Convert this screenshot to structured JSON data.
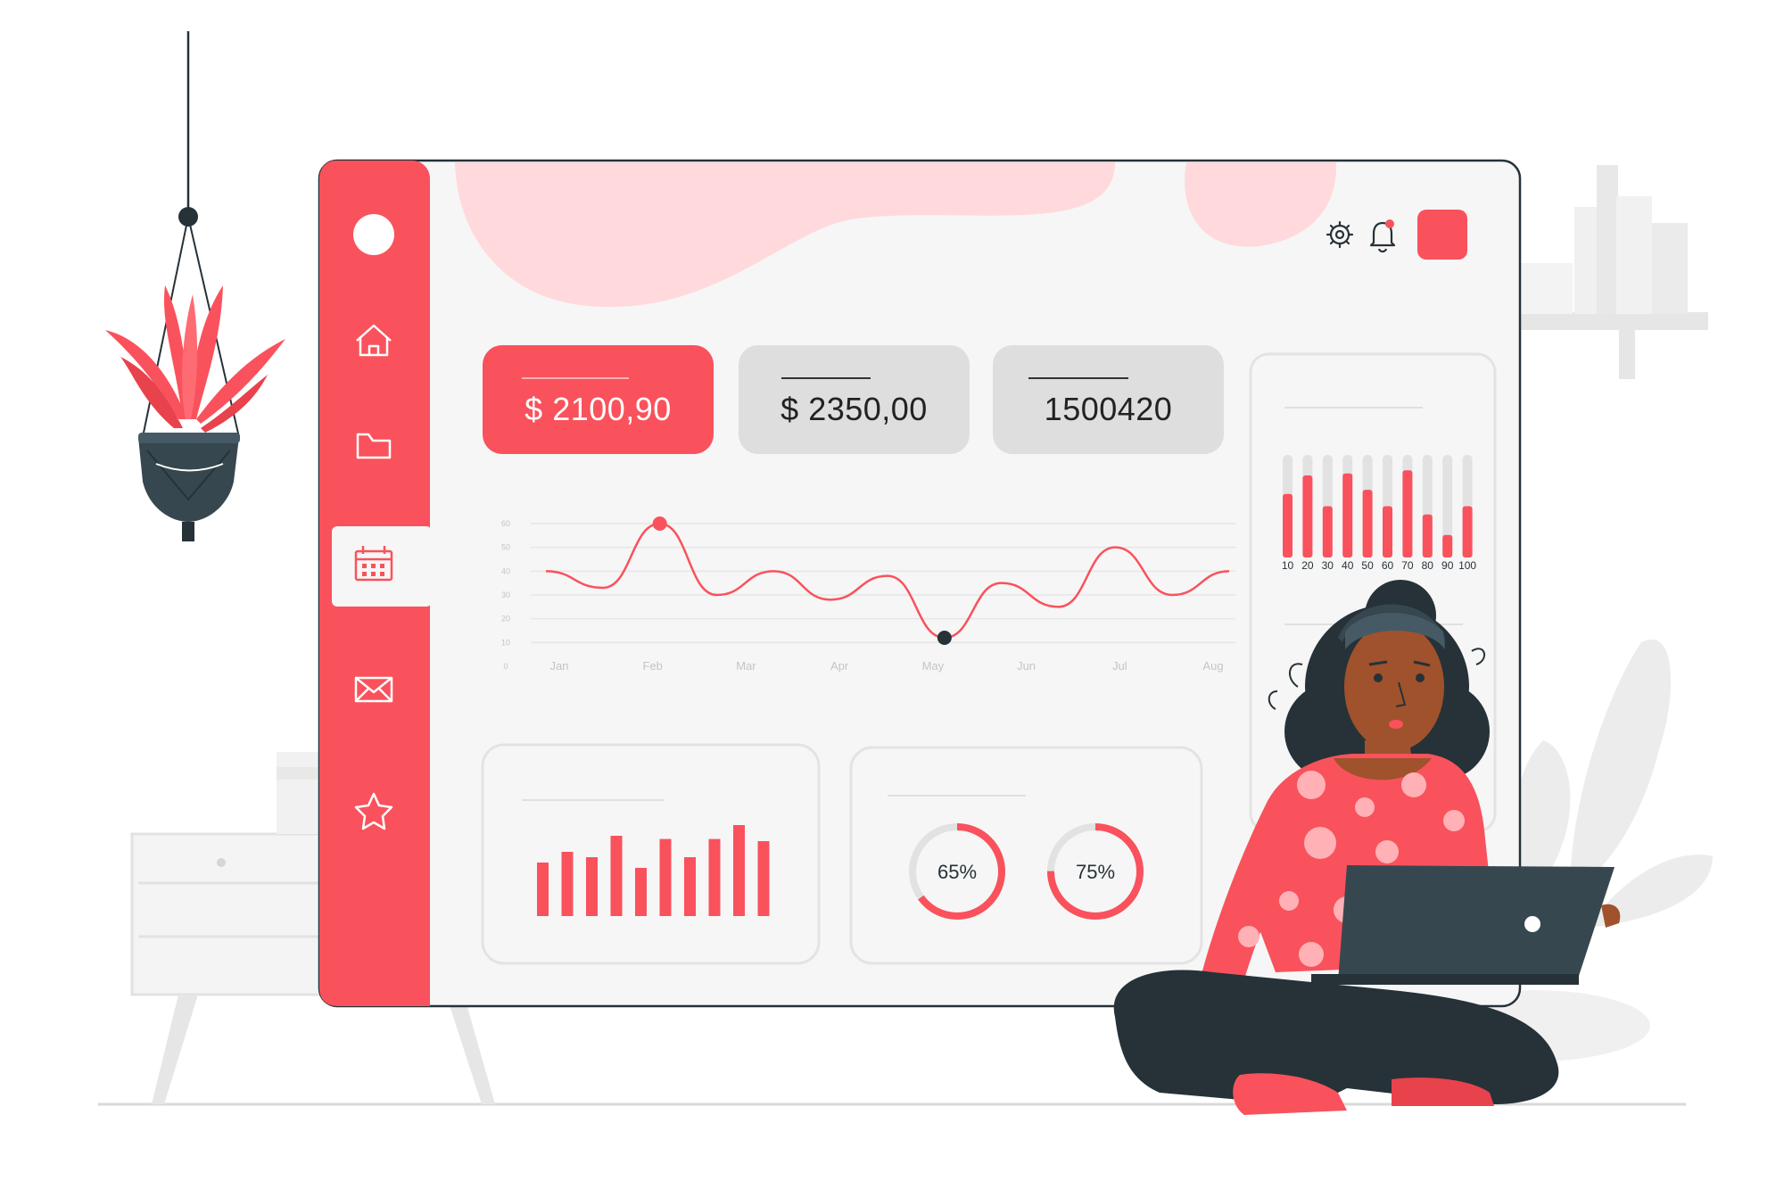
{
  "colors": {
    "accent": "#f9525c",
    "accent_light": "#ffd9dc",
    "grey_card": "#dedede",
    "dark": "#263238",
    "panel_bg": "#f6f6f6"
  },
  "sidebar": {
    "items": [
      {
        "name": "avatar",
        "icon": "circle"
      },
      {
        "name": "home",
        "icon": "home-icon"
      },
      {
        "name": "folder",
        "icon": "folder-icon"
      },
      {
        "name": "calendar",
        "icon": "calendar-icon",
        "active": true
      },
      {
        "name": "mail",
        "icon": "mail-icon"
      },
      {
        "name": "star",
        "icon": "star-icon"
      }
    ]
  },
  "header": {
    "icons": [
      "gear-icon",
      "bell-icon",
      "profile-square"
    ]
  },
  "stats": [
    {
      "value": "$ 2100,90",
      "style": "accent"
    },
    {
      "value": "$ 2350,00",
      "style": "grey"
    },
    {
      "value": "1500420",
      "style": "grey"
    }
  ],
  "chart_data": [
    {
      "type": "line",
      "categories": [
        "Jan",
        "Feb",
        "Mar",
        "Apr",
        "May",
        "Jun",
        "Jul",
        "Aug"
      ],
      "y_ticks": [
        0,
        10,
        20,
        30,
        40,
        50,
        60
      ],
      "ylim": [
        0,
        60
      ],
      "values": [
        40,
        33,
        60,
        30,
        40,
        28,
        38,
        12,
        35,
        25,
        50,
        30,
        40
      ],
      "highlight": [
        {
          "index": 2,
          "color": "#f9525c"
        },
        {
          "index": 7,
          "color": "#263238"
        }
      ],
      "grid": true
    },
    {
      "type": "bar",
      "categories": [
        "10",
        "20",
        "30",
        "40",
        "50",
        "60",
        "70",
        "80",
        "90",
        "100"
      ],
      "values": [
        62,
        80,
        50,
        82,
        66,
        50,
        85,
        42,
        22,
        50
      ],
      "ylim": [
        0,
        100
      ],
      "stacked_background": true
    },
    {
      "type": "bar",
      "values": [
        50,
        60,
        55,
        75,
        45,
        72,
        55,
        72,
        85,
        70
      ],
      "ylim": [
        0,
        100
      ]
    },
    {
      "type": "pie",
      "donuts": [
        {
          "label": "65%",
          "value": 65
        },
        {
          "label": "75%",
          "value": 75
        }
      ]
    }
  ]
}
